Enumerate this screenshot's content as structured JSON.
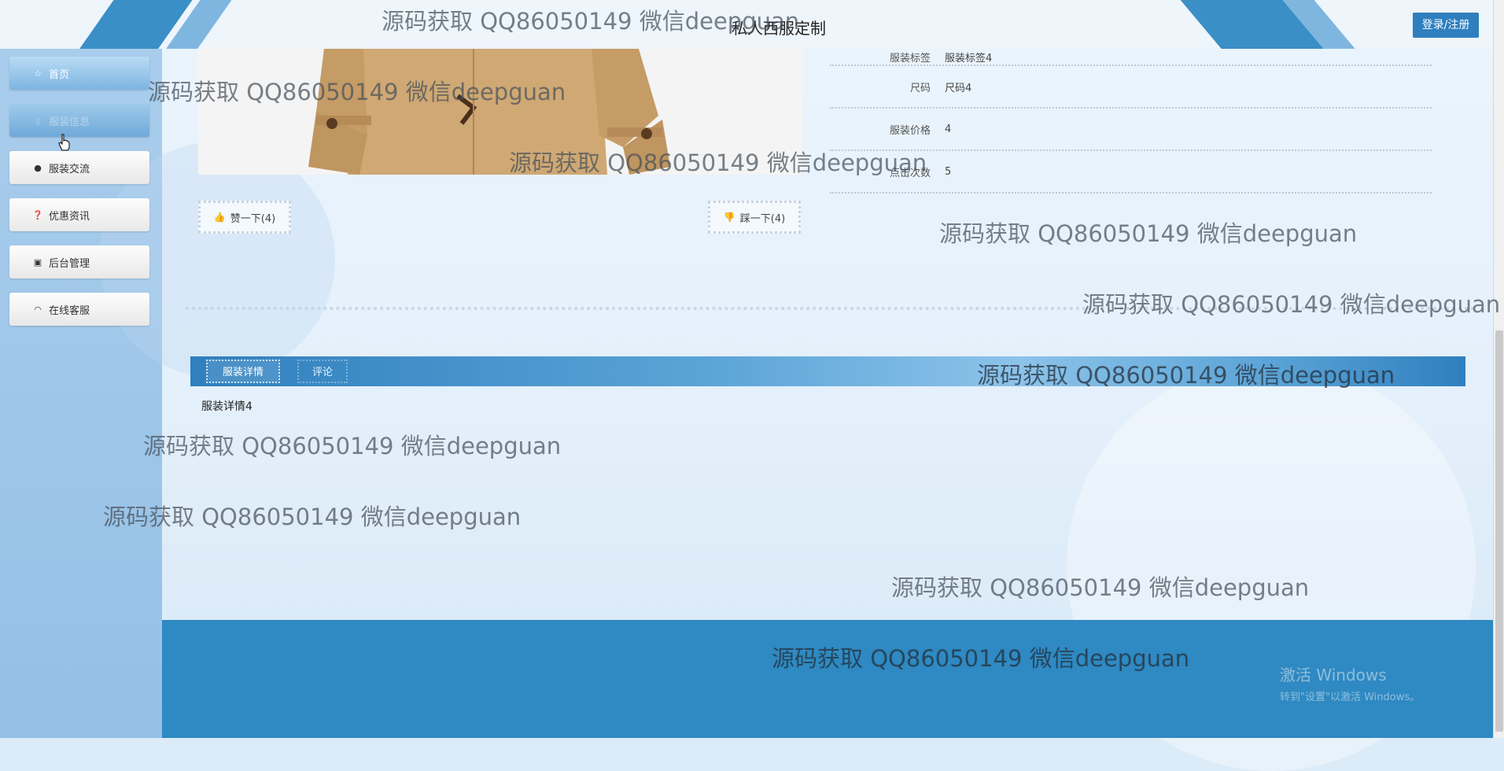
{
  "header": {
    "site_title": "私人西服定制",
    "login_label": "登录/注册"
  },
  "sidebar": {
    "items": [
      {
        "label": "首页",
        "icon": "home-icon"
      },
      {
        "label": "服装信息",
        "icon": "document-icon"
      },
      {
        "label": "服装交流",
        "icon": "info-circle-icon"
      },
      {
        "label": "优惠资讯",
        "icon": "question-circle-icon"
      },
      {
        "label": "后台管理",
        "icon": "briefcase-icon"
      },
      {
        "label": "在线客服",
        "icon": "headset-icon"
      }
    ]
  },
  "product": {
    "info_rows": [
      {
        "label": "服装标签",
        "value": "服装标签4"
      },
      {
        "label": "尺码",
        "value": "尺码4"
      },
      {
        "label": "服装价格",
        "value": "4"
      },
      {
        "label": "点击次数",
        "value": "5"
      }
    ],
    "like_label": "赞一下(4)",
    "dislike_label": "踩一下(4)"
  },
  "tabs": {
    "detail": "服装详情",
    "comments": "评论",
    "detail_text": "服装详情4"
  },
  "watermark": "源码获取 QQ86050149 微信deepguan",
  "system": {
    "activate_title": "激活 Windows",
    "activate_sub": "转到\"设置\"以激活 Windows。"
  },
  "colors": {
    "primary": "#2f89c2",
    "tab_bar": "#2f7fbe",
    "sidebar": "#a9cdec"
  }
}
